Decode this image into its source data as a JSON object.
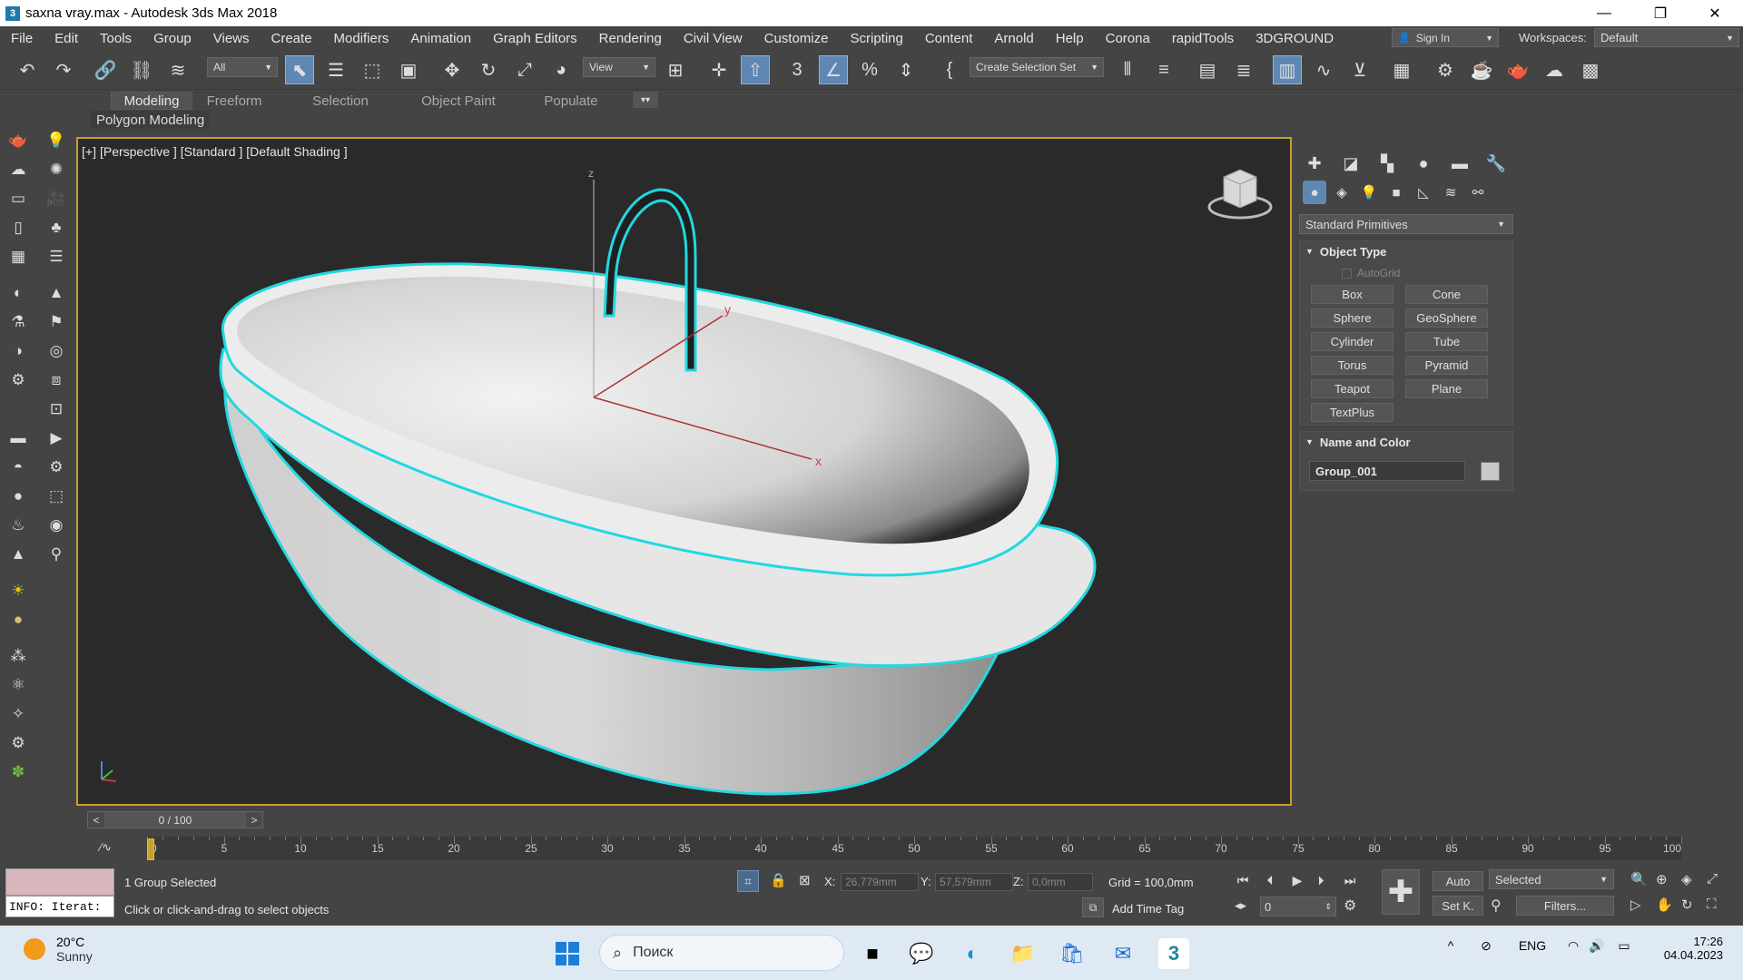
{
  "window": {
    "title": "saxna vray.max - Autodesk 3ds Max 2018",
    "app_icon": "3",
    "controls": {
      "minimize": "—",
      "restore": "❐",
      "close": "✕"
    }
  },
  "menu": {
    "items": [
      "File",
      "Edit",
      "Tools",
      "Group",
      "Views",
      "Create",
      "Modifiers",
      "Animation",
      "Graph Editors",
      "Rendering",
      "Civil View",
      "Customize",
      "Scripting",
      "Content",
      "Arnold",
      "Help",
      "Corona",
      "rapidTools",
      "3DGROUND"
    ],
    "sign_in": "Sign In",
    "workspaces_label": "Workspaces:",
    "workspace_value": "Default"
  },
  "toolbar": {
    "filter_value": "All",
    "ref_coord_value": "View",
    "selection_set_value": "Create Selection Set"
  },
  "ribbon": {
    "tabs": [
      "Modeling",
      "Freeform",
      "Selection",
      "Object Paint",
      "Populate"
    ],
    "active_tab": "Modeling",
    "panel_label": "Polygon Modeling"
  },
  "viewport": {
    "label_parts": [
      "[+]",
      "[Perspective ]",
      "[Standard ]",
      "[Default Shading ]"
    ],
    "axis_x": "x",
    "axis_y": "y",
    "axis_z": "z",
    "selection_color": "#22d8e0"
  },
  "command_panel": {
    "category_value": "Standard Primitives",
    "object_type": {
      "title": "Object Type",
      "autogrid_label": "AutoGrid",
      "buttons": [
        "Box",
        "Cone",
        "Sphere",
        "GeoSphere",
        "Cylinder",
        "Tube",
        "Torus",
        "Pyramid",
        "Teapot",
        "Plane",
        "TextPlus"
      ]
    },
    "name_color": {
      "title": "Name and Color",
      "name_value": "Group_001",
      "color": "#c8c8c8"
    }
  },
  "timeline": {
    "slider_text": "0 / 100",
    "prev": "<",
    "next": ">",
    "current_frame": 0,
    "tick_labels": [
      "0",
      "5",
      "10",
      "15",
      "20",
      "25",
      "30",
      "35",
      "40",
      "45",
      "50",
      "55",
      "60",
      "65",
      "70",
      "75",
      "80",
      "85",
      "90",
      "95",
      "100"
    ]
  },
  "status": {
    "maxscript_text": "INFO: Iterat:",
    "selection_info": "1 Group Selected",
    "prompt": "Click or click-and-drag to select objects",
    "x_label": "X:",
    "x_value": "26,779mm",
    "y_label": "Y:",
    "y_value": "57,579mm",
    "z_label": "Z:",
    "z_value": "0,0mm",
    "grid": "Grid = 100,0mm",
    "add_time_tag": "Add Time Tag",
    "auto_key": "Auto",
    "set_key": "Set K.",
    "selected_value": "Selected",
    "filters": "Filters...",
    "frame_value": "0"
  },
  "taskbar": {
    "weather_temp": "20°C",
    "weather_desc": "Sunny",
    "search_placeholder": "Поиск",
    "lang": "ENG",
    "time": "17:26",
    "date": "04.04.2023"
  }
}
